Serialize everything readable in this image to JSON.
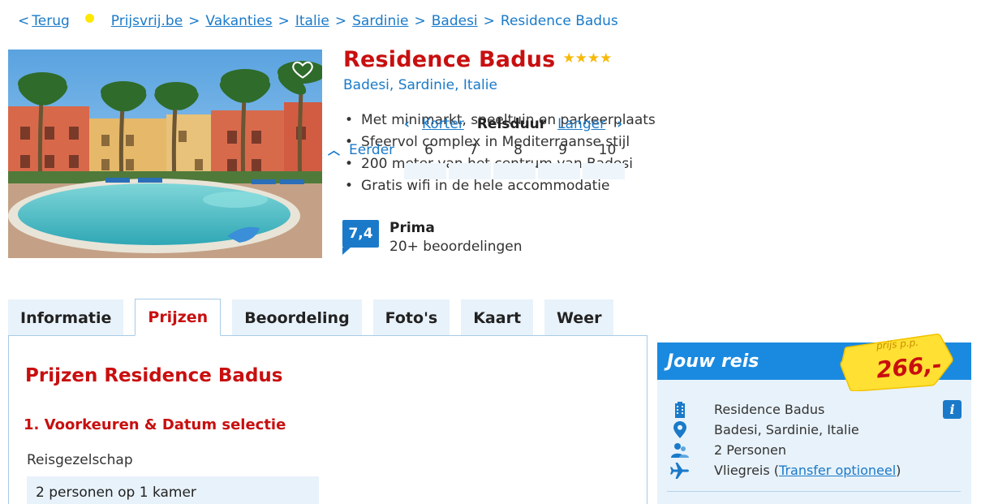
{
  "breadcrumb": {
    "back_chevron": "<",
    "back_label": "Terug",
    "items": [
      "Prijsvrij.be",
      "Vakanties",
      "Italie",
      "Sardinie",
      "Badesi"
    ],
    "current": "Residence Badus",
    "separator": ">"
  },
  "hotel": {
    "name": "Residence Badus",
    "stars": "★★★★",
    "location": "Badesi, Sardinie, Italie",
    "usps": [
      "Met minimarkt, speeltuin en parkeerplaats",
      "Sfeervol complex in Mediterraanse stijl",
      "200 meter van het centrum van Badesi",
      "Gratis wifi in de hele accommodatie"
    ]
  },
  "rating": {
    "score": "7,4",
    "label": "Prima",
    "count": "20+ beoordelingen"
  },
  "tabs": [
    "Informatie",
    "Prijzen",
    "Beoordeling",
    "Foto's",
    "Kaart",
    "Weer"
  ],
  "active_tab": "Prijzen",
  "prices": {
    "title": "Prijzen Residence Badus",
    "section": "1. Voorkeuren & Datum selectie",
    "party_label": "Reisgezelschap",
    "party_value": "2 personen op 1 kamer",
    "duration": {
      "shorter": "Korter",
      "label": "Reisduur",
      "longer": "Langer",
      "earlier": "Eerder",
      "days": [
        "6",
        "7",
        "8",
        "9",
        "10"
      ]
    }
  },
  "trip": {
    "heading": "Jouw reis",
    "price_label": "prijs p.p.",
    "price": "266,-",
    "hotel": "Residence Badus",
    "location": "Badesi, Sardinie, Italie",
    "persons": "2 Personen",
    "travel_prefix": "Vliegreis (",
    "transfer_link": "Transfer optioneel",
    "travel_suffix": ")",
    "info_icon": "i"
  },
  "colors": {
    "brand_red": "#c80f0f",
    "link_blue": "#1a7ac9",
    "header_blue": "#1a8ae0",
    "light_blue": "#e8f2fa",
    "star_gold": "#f7b90b",
    "price_yellow": "#ffe033"
  }
}
